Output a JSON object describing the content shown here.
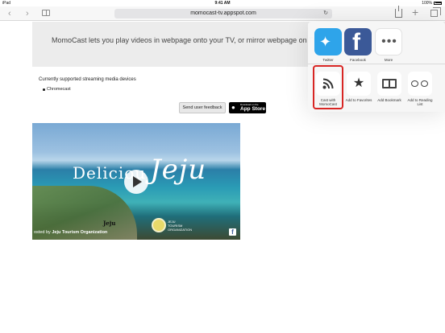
{
  "status_bar": {
    "device": "iPad",
    "wifi_icon": "wifi-icon",
    "time": "9:41 AM",
    "battery": "100%"
  },
  "toolbar": {
    "url": "momocast-tv.appspot.com"
  },
  "banner": {
    "text": "MomoCast lets you play videos in webpage onto your TV, or mirror webpage on TV."
  },
  "devices": {
    "title": "Currently supported streaming media devices",
    "items": [
      "Chromecast"
    ]
  },
  "buttons": {
    "feedback": "Send user feedback",
    "appstore_small": "Download on the",
    "appstore_big": "App Store"
  },
  "video": {
    "title_prefix": "Deliciou",
    "title_main": "Jeju",
    "caption_prefix": "osted by ",
    "caption_org": "Jeju Tourism Organization",
    "caption_overlay": "Jeju",
    "logo_text_line1": "JEJU",
    "logo_text_line2": "TOURISM",
    "logo_text_line3": "ORGANIZATION",
    "facebook_letter": "f"
  },
  "share_sheet": {
    "apps": [
      {
        "label": "Twitter",
        "icon": "twitter-bird-icon"
      },
      {
        "label": "Facebook",
        "icon": "facebook-f-icon"
      },
      {
        "label": "More",
        "icon": "more-dots-icon"
      }
    ],
    "actions": [
      {
        "label": "Cast with MomoCast",
        "icon": "rss-cast-icon"
      },
      {
        "label": "Add to Favorites",
        "icon": "star-icon"
      },
      {
        "label": "Add Bookmark",
        "icon": "book-icon"
      },
      {
        "label": "Add to Reading List",
        "icon": "glasses-icon"
      }
    ],
    "highlight_color": "#d82624"
  }
}
